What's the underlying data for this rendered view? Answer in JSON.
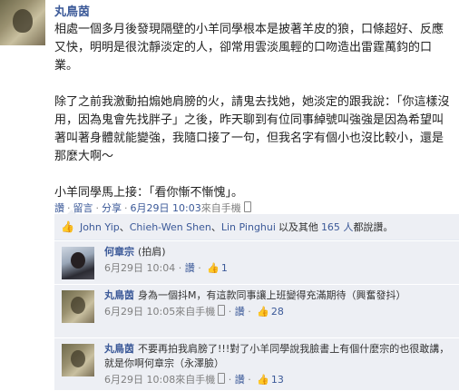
{
  "post": {
    "author": "丸鳥茵",
    "paragraphs": [
      "相處一個多月後發現隔壁的小羊同學根本是披著羊皮的狼，口條超好、反應又快，明明是很沈靜淡定的人，卻常用雲淡風輕的口吻造出雷霆萬鈞的口業。",
      "除了之前我激動拍煽她肩膀的火，請鬼去找她，她淡定的跟我說：「你這樣沒用，因為鬼會先找胖子」之後，昨天聊到有位同事綽號叫強強是因為希望叫著叫著身體就能變強，我隨口接了一句，但我名字有個小也沒比較小，還是那麼大啊～",
      "小羊同學馬上接：「看你慚不慚愧」。"
    ],
    "actions": {
      "like": "讚",
      "comment": "留言",
      "share": "分享",
      "time": "6月29日 10:03",
      "via": "來自手機"
    }
  },
  "likes": {
    "names": [
      "John Yip",
      "Chieh-Wen Shen",
      "Lin Pinghui"
    ],
    "others_prefix": "以及其他",
    "others_count": "165 人",
    "suffix": "都說讚。"
  },
  "comments": [
    {
      "name": "何章宗",
      "text": "(拍肩)",
      "time": "6月29日 10:04",
      "via": "",
      "like": "讚",
      "like_count": "1"
    },
    {
      "name": "丸鳥茵",
      "text": "身為一個抖M，有這款同事讓上班變得充滿期待（興奮發抖）",
      "time": "6月29日 10:05",
      "via": "來自手機",
      "like": "讚",
      "like_count": "28"
    },
    {
      "name": "丸鳥茵",
      "text": "不要再拍我肩膀了!!!對了小羊同學說我臉書上有個什麼宗的也很敢講，就是你啊何章宗（永澤臉）",
      "time": "6月29日 10:08",
      "via": "來自手機",
      "like": "讚",
      "like_count": "13"
    }
  ],
  "icons": [
    "avatar",
    "thumbs-up-icon",
    "mobile-icon"
  ],
  "colors": {
    "link": "#3b5998",
    "panel": "#edeff4",
    "meta": "#808080"
  }
}
